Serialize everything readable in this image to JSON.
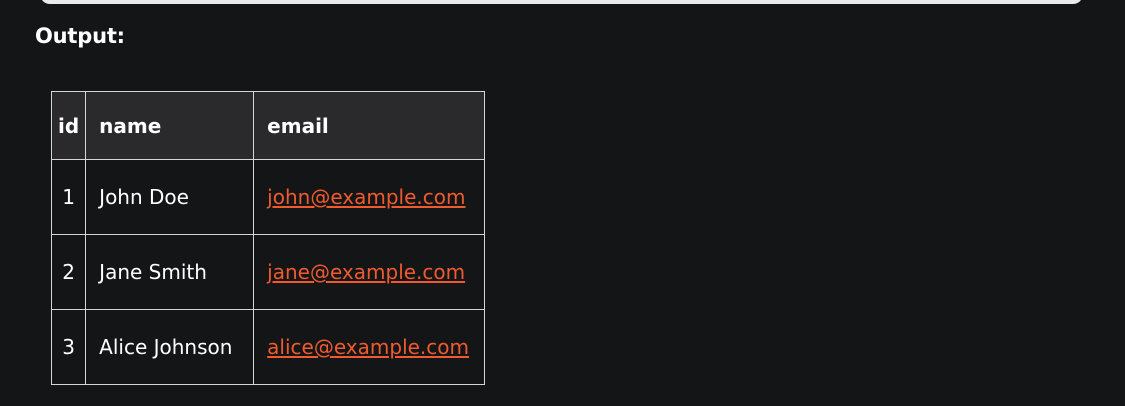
{
  "output": {
    "label": "Output:"
  },
  "table": {
    "headers": [
      "id",
      "name",
      "email"
    ],
    "rows": [
      {
        "id": "1",
        "name": "John Doe",
        "email": "john@example.com"
      },
      {
        "id": "2",
        "name": "Jane Smith",
        "email": "jane@example.com"
      },
      {
        "id": "3",
        "name": "Alice Johnson",
        "email": "alice@example.com"
      }
    ]
  },
  "colors": {
    "background": "#141517",
    "header_background": "#2a2a2c",
    "link": "#ef5a2e",
    "border": "#d6d6d6"
  }
}
